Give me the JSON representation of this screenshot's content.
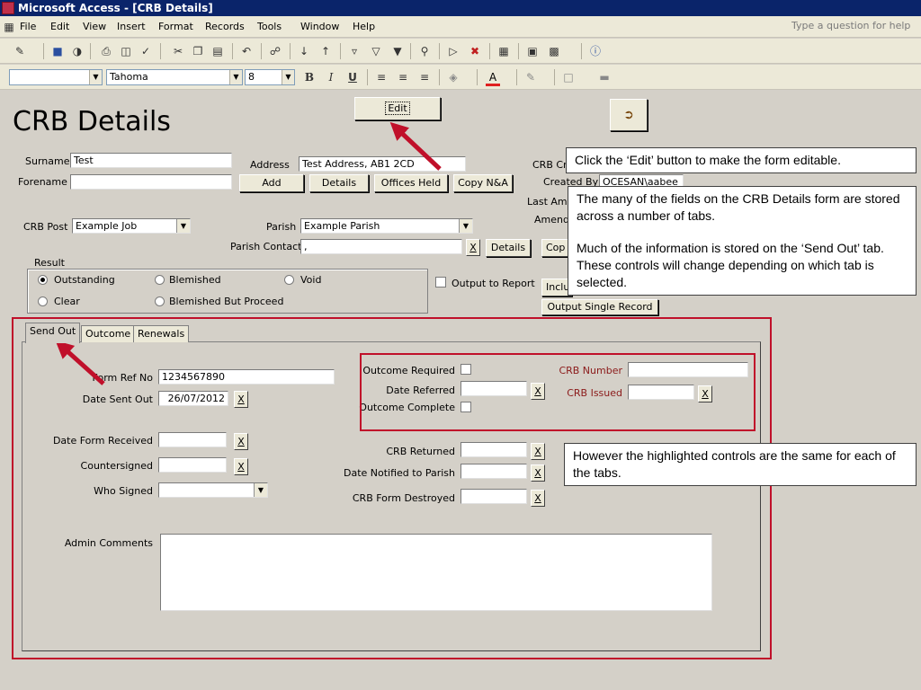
{
  "window": {
    "title": "Microsoft Access - [CRB Details]"
  },
  "menu": {
    "items": [
      "File",
      "Edit",
      "View",
      "Insert",
      "Format",
      "Records",
      "Tools",
      "Window",
      "Help"
    ],
    "help_placeholder": "Type a question for help"
  },
  "format_toolbar": {
    "object_combo": "",
    "font_name": "Tahoma",
    "font_size": "8",
    "bold": "B",
    "italic": "I",
    "underline": "U"
  },
  "form": {
    "title": "CRB Details",
    "edit_button": "Edit",
    "surname_label": "Surname",
    "surname_value": "Test",
    "forename_label": "Forename",
    "forename_value": "",
    "address_label": "Address",
    "address_value": "Test Address, AB1 2CD",
    "add_button": "Add",
    "details_button": "Details",
    "offices_held_button": "Offices Held",
    "copy_na_button": "Copy N&A",
    "crb_created_label": "CRB Cr",
    "created_by_label": "Created By",
    "created_by_value": "OCESAN\\aabee",
    "last_amended_label": "Last Ame",
    "amended_label": "Amend",
    "crb_post_label": "CRB Post",
    "crb_post_value": "Example Job",
    "parish_label": "Parish",
    "parish_value": "Example Parish",
    "parish_contact_label": "Parish Contact",
    "parish_contact_value": ",",
    "parish_contact_clear": "X",
    "parish_details_button": "Details",
    "copy_button_partial": "Cop",
    "result_label": "Result",
    "result_options": [
      "Outstanding",
      "Blemished",
      "Void",
      "Clear",
      "Blemished But Proceed"
    ],
    "result_selected": "Outstanding",
    "output_to_report_label": "Output to Report",
    "include_button_partial": "Inclu",
    "output_single_record_button": "Output Single Record"
  },
  "tabs": [
    {
      "label": "Send Out",
      "active": true
    },
    {
      "label": "Outcome",
      "active": false
    },
    {
      "label": "Renewals",
      "active": false
    }
  ],
  "send_out": {
    "form_ref_label": "Form Ref No",
    "form_ref_value": "1234567890",
    "date_sent_label": "Date Sent Out",
    "date_sent_value": "26/07/2012",
    "date_form_received_label": "Date Form Received",
    "countersigned_label": "Countersigned",
    "who_signed_label": "Who Signed",
    "admin_comments_label": "Admin Comments",
    "crb_returned_label": "CRB Returned",
    "date_notified_label": "Date Notified to Parish",
    "crb_form_destroyed_label": "CRB Form Destroyed",
    "clear_glyph": "X"
  },
  "common": {
    "outcome_required_label": "Outcome Required",
    "date_referred_label": "Date Referred",
    "outcome_complete_label": "Outcome Complete",
    "crb_number_label": "CRB Number",
    "crb_issued_label": "CRB Issued"
  },
  "callouts": {
    "edit": "Click the ‘Edit’ button to make the form editable.",
    "tabs_1": "The many of the fields on the CRB Details form are stored across a number of tabs.",
    "tabs_2": "Much of the information is stored on the ‘Send Out’ tab. These controls will change depending on which tab is selected.",
    "highlight": "However the highlighted controls are the same for each of the tabs."
  },
  "colors": {
    "highlight_red": "#c0102a",
    "title_bar": "#0a246a"
  }
}
